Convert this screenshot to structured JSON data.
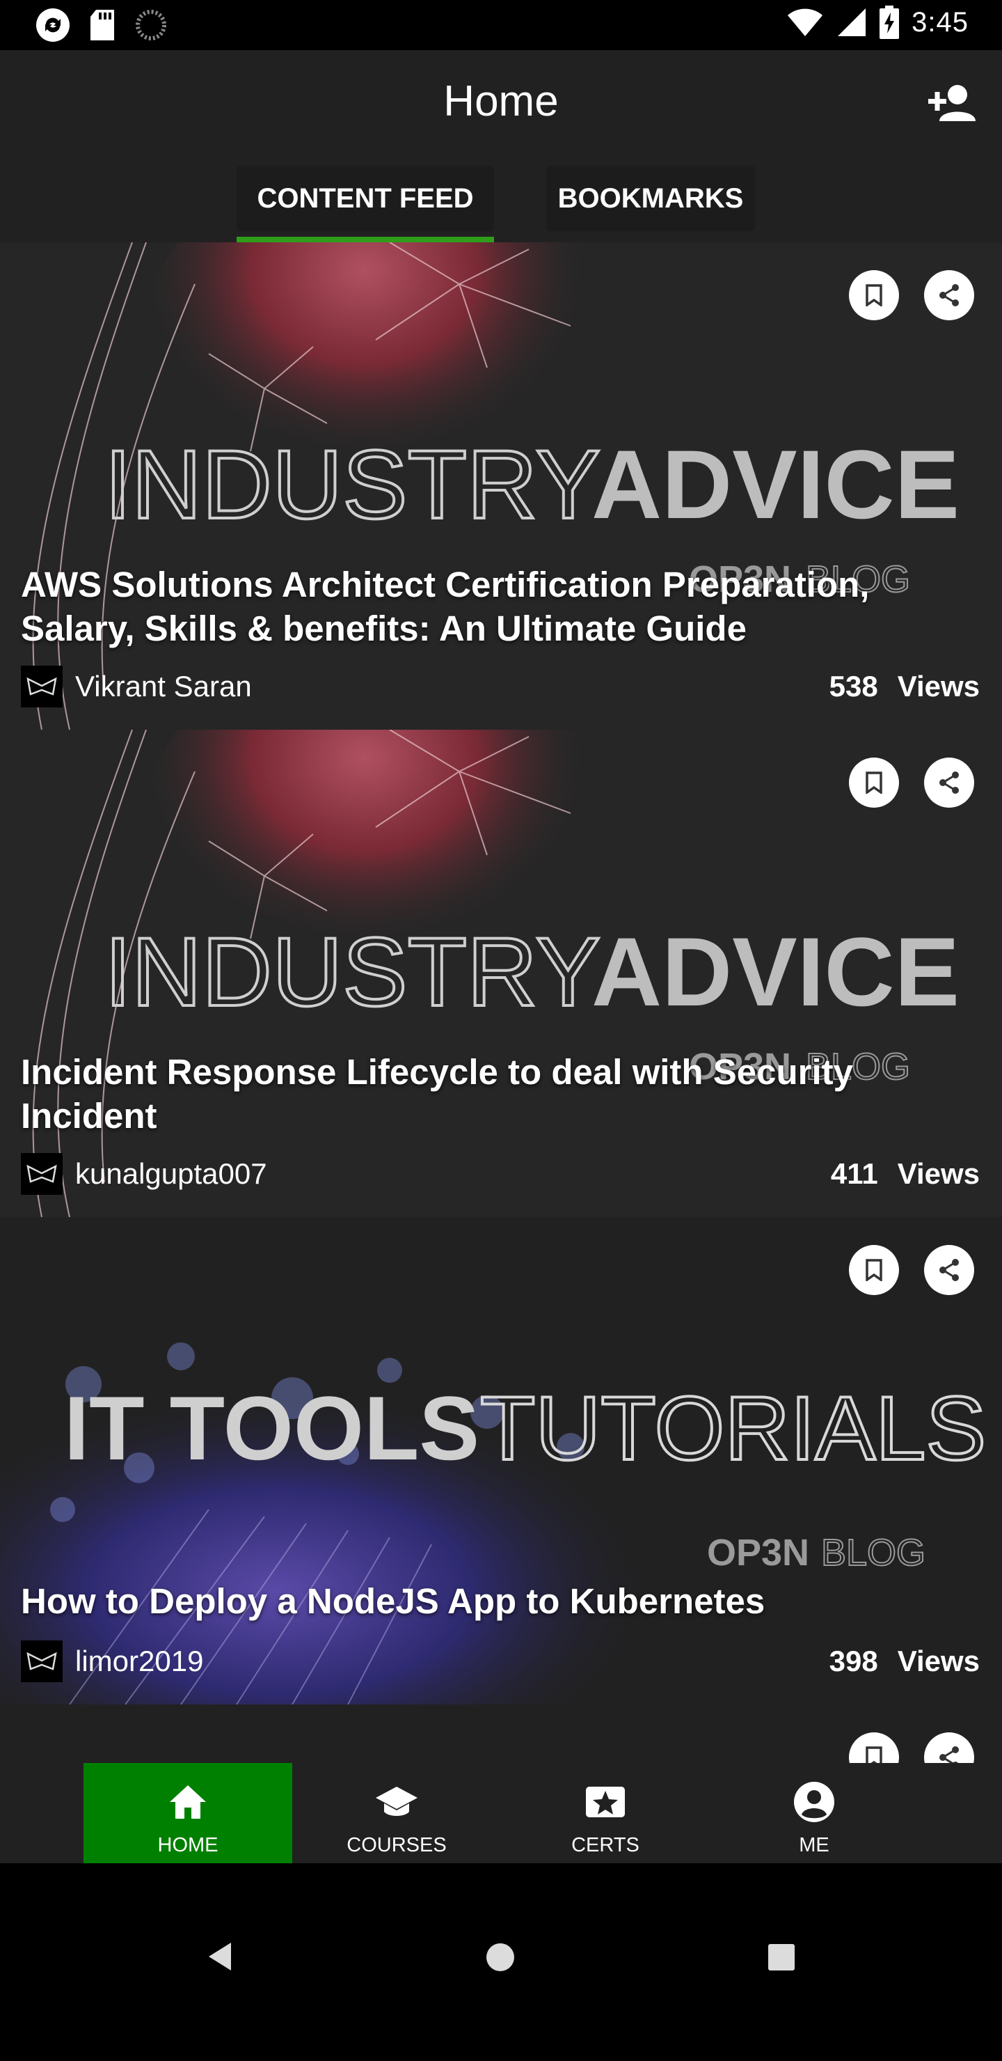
{
  "status_bar": {
    "time": "3:45"
  },
  "app_bar": {
    "title": "Home"
  },
  "tabs": [
    {
      "label": "CONTENT FEED",
      "selected": true
    },
    {
      "label": "BOOKMARKS",
      "selected": false
    }
  ],
  "cards": [
    {
      "banner_text_1": "INDUSTRY",
      "banner_text_2": "ADVICE",
      "brand_1": "OP3N",
      "brand_2": "BLOG",
      "title": "AWS Solutions Architect Certification Preparation, Salary, Skills & benefits: An Ultimate Guide",
      "author": "Vikrant Saran",
      "views": "538",
      "views_label": "Views"
    },
    {
      "banner_text_1": "INDUSTRY",
      "banner_text_2": "ADVICE",
      "brand_1": "OP3N",
      "brand_2": "BLOG",
      "title": "Incident Response Lifecycle to deal with Security Incident",
      "author": "kunalgupta007",
      "views": "411",
      "views_label": "Views"
    },
    {
      "banner_text_1": "IT TOOLS",
      "banner_text_2": "TUTORIALS",
      "brand_1": "OP3N",
      "brand_2": "BLOG",
      "title": "How to Deploy a NodeJS App to Kubernetes",
      "author": "limor2019",
      "views": "398",
      "views_label": "Views"
    }
  ],
  "bottom_nav": [
    {
      "label": "HOME",
      "icon": "home-icon",
      "active": true
    },
    {
      "label": "COURSES",
      "icon": "school-icon",
      "active": false
    },
    {
      "label": "CERTS",
      "icon": "star-badge-icon",
      "active": false
    },
    {
      "label": "ME",
      "icon": "account-circle-icon",
      "active": false
    }
  ],
  "colors": {
    "background": "#212121",
    "accent_green": "#008000",
    "tab_indicator": "#2e9e1a",
    "status_bar": "#000000"
  }
}
